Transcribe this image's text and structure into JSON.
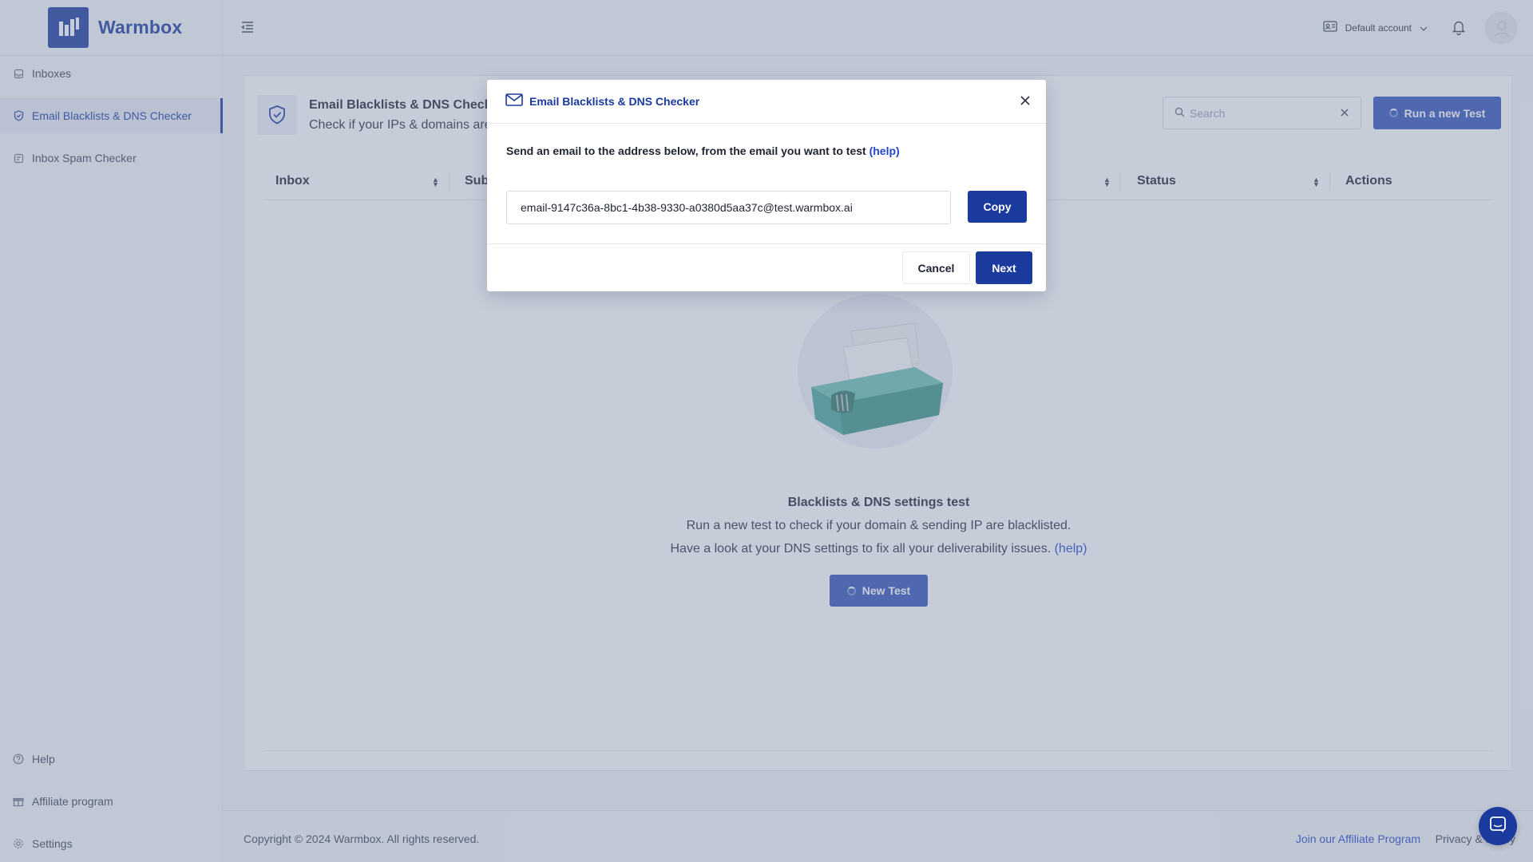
{
  "app": {
    "name": "Warmbox"
  },
  "sidebar": {
    "items": [
      {
        "label": "Inboxes",
        "icon": "inbox-icon"
      },
      {
        "label": "Email Blacklists & DNS Checker",
        "icon": "shield-icon",
        "active": true
      },
      {
        "label": "Inbox Spam Checker",
        "icon": "spam-checker-icon"
      }
    ],
    "bottom_items": [
      {
        "label": "Help",
        "icon": "help-circle-icon"
      },
      {
        "label": "Affiliate program",
        "icon": "gift-icon"
      },
      {
        "label": "Settings",
        "icon": "gear-icon"
      }
    ]
  },
  "header": {
    "account_label": "Default account"
  },
  "page": {
    "title": "Email Blacklists & DNS Checker",
    "subtitle": "Check if your IPs & domains are",
    "search_placeholder": "Search",
    "run_button": "Run a new Test",
    "table": {
      "columns": [
        "Inbox",
        "Sub",
        "Status",
        "Actions"
      ]
    },
    "empty": {
      "title": "Blacklists & DNS settings test",
      "line1": "Run a new test to check if your domain & sending IP are blacklisted.",
      "line2": "Have a look at your DNS settings to fix all your deliverability issues.",
      "help_link": "(help)",
      "button": "New Test"
    }
  },
  "footer": {
    "copyright": "Copyright © 2024 Warmbox. All rights reserved.",
    "affiliate_link": "Join our Affiliate Program",
    "privacy": "Privacy & Policy"
  },
  "modal": {
    "title": "Email Blacklists & DNS Checker",
    "instruction": "Send an email to the address below, from the email you want to test",
    "help_link": "(help)",
    "email_value": "email-9147c36a-8bc1-4b38-9330-a0380d5aa37c@test.warmbox.ai",
    "copy_button": "Copy",
    "cancel_button": "Cancel",
    "next_button": "Next"
  },
  "colors": {
    "brand": "#1b3a9e",
    "link": "#2447c9",
    "overlay": "#7686a3"
  }
}
